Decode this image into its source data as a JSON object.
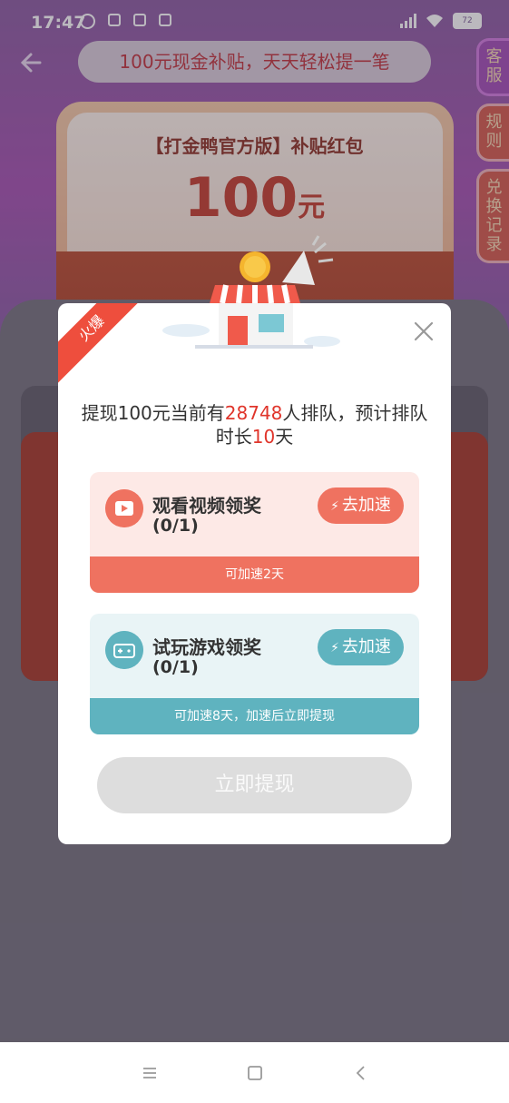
{
  "status_bar": {
    "time": "17:47",
    "battery": "72"
  },
  "header": {
    "banner": "100元现金补贴，天天轻松提一笔"
  },
  "side_tabs": {
    "service": "客服",
    "rules": "规则",
    "records": "兑换记录"
  },
  "envelope": {
    "title": "【打金鸭官方版】补贴红包",
    "amount": "100",
    "unit": "元"
  },
  "modal": {
    "ribbon": "火爆",
    "queue_prefix": "提现100元当前有",
    "queue_count": "28748",
    "queue_middle": "人排队，预计排队时长",
    "queue_days": "10",
    "queue_suffix": "天",
    "tasks": [
      {
        "title": "观看视频领奖",
        "progress": "(0/1)",
        "button": "去加速",
        "footer": "可加速2天"
      },
      {
        "title": "试玩游戏领奖",
        "progress": "(0/1)",
        "button": "去加速",
        "footer": "可加速8天，加速后立即提现"
      }
    ],
    "withdraw_button": "立即提现"
  },
  "colors": {
    "video_accent": "#ef7260",
    "game_accent": "#5fb3bf",
    "highlight": "#e0352b"
  }
}
